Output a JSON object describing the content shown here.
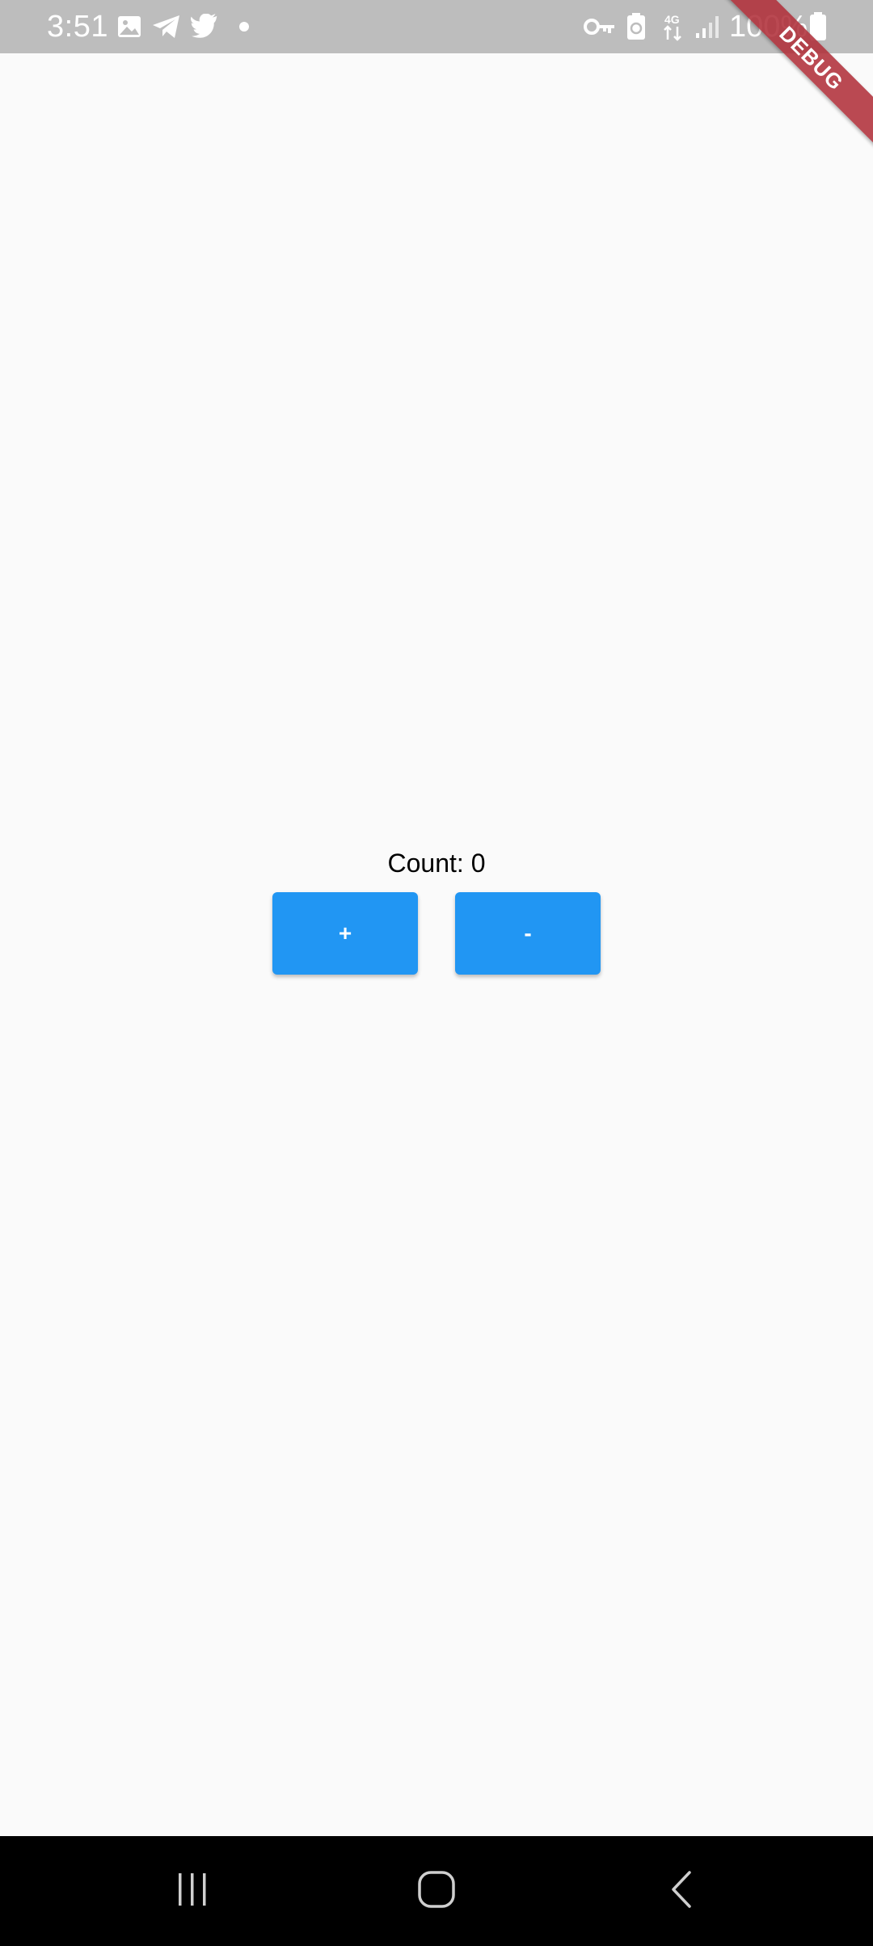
{
  "status_bar": {
    "time": "3:51",
    "battery": "100%",
    "background": "#bdbdbd"
  },
  "debug_banner": {
    "label": "DEBUG",
    "color": "#b0303a"
  },
  "counter": {
    "label": "Count: 0",
    "increment_label": "+",
    "decrement_label": "-",
    "button_color": "#2196f3"
  },
  "nav_bar": {
    "recents": "recents-icon",
    "home": "home-icon",
    "back": "back-icon"
  }
}
